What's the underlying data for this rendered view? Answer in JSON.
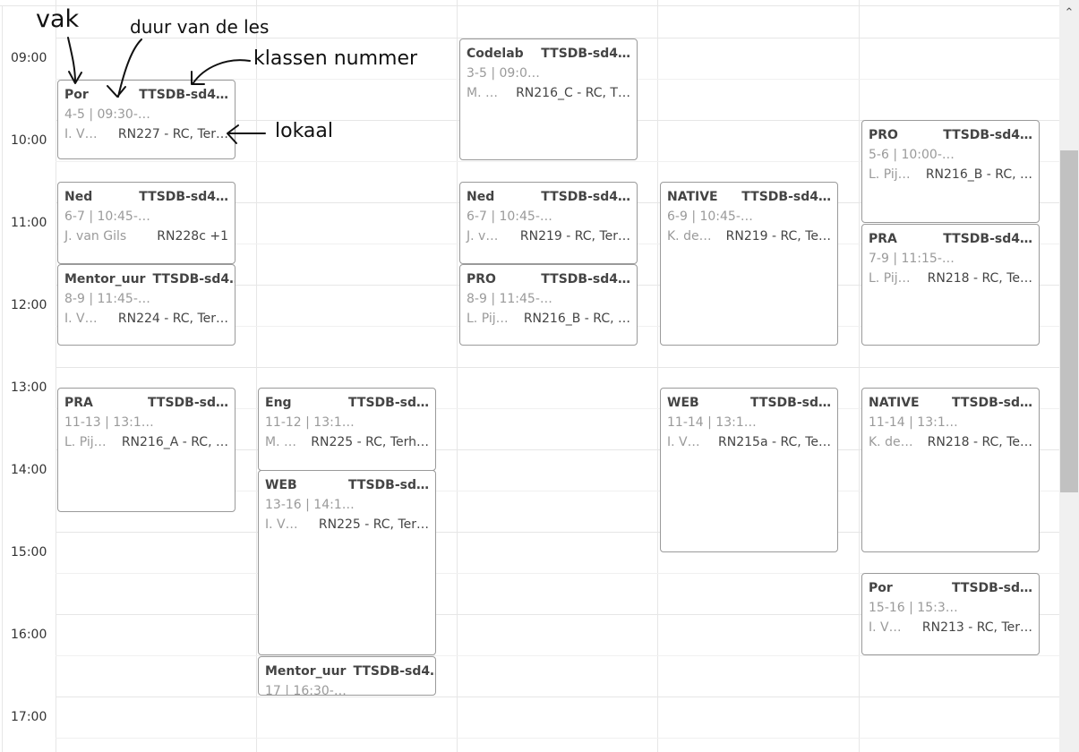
{
  "time_labels": [
    "09:00",
    "10:00",
    "11:00",
    "12:00",
    "13:00",
    "14:00",
    "15:00",
    "16:00",
    "17:00"
  ],
  "annotations": {
    "subject": "vak",
    "duration": "duur van de les",
    "class_number": "klassen nummer",
    "room": "lokaal"
  },
  "events": [
    {
      "subject": "Por",
      "class": "TTSDB-sd4…",
      "time": "4-5 | 09:30-…",
      "teacher": "I. V…",
      "room": "RN227 - RC, Ter…"
    },
    {
      "subject": "Ned",
      "class": "TTSDB-sd4…",
      "time": "6-7 | 10:45-…",
      "teacher": "J. van Gils",
      "room": "RN228c +1"
    },
    {
      "subject": "Mentor_uur",
      "class": "TTSDB-sd4…",
      "time": "8-9 | 11:45-…",
      "teacher": "I. V…",
      "room": "RN224 - RC, Ter…"
    },
    {
      "subject": "PRA",
      "class": "TTSDB-sd…",
      "time": "11-13 | 13:1…",
      "teacher": "L. Pij…",
      "room": "RN216_A - RC, …"
    },
    {
      "subject": "Eng",
      "class": "TTSDB-sd…",
      "time": "11-12 | 13:1…",
      "teacher": "M. …",
      "room": "RN225 - RC, Terh…"
    },
    {
      "subject": "WEB",
      "class": "TTSDB-sd…",
      "time": "13-16 | 14:1…",
      "teacher": "I. V…",
      "room": "RN225 - RC, Ter…"
    },
    {
      "subject": "Mentor_uur",
      "class": "TTSDB-sd4…",
      "time": "17 | 16:30-…",
      "teacher": "",
      "room": ""
    },
    {
      "subject": "Codelab",
      "class": "TTSDB-sd4…",
      "time": "3-5 | 09:0…",
      "teacher": "M. …",
      "room": "RN216_C - RC, T…"
    },
    {
      "subject": "Ned",
      "class": "TTSDB-sd4…",
      "time": "6-7 | 10:45-…",
      "teacher": "J. v…",
      "room": "RN219 - RC, Ter…"
    },
    {
      "subject": "PRO",
      "class": "TTSDB-sd4…",
      "time": "8-9 | 11:45-…",
      "teacher": "L. Pij…",
      "room": "RN216_B - RC, …"
    },
    {
      "subject": "NATIVE",
      "class": "TTSDB-sd4…",
      "time": "6-9 | 10:45-…",
      "teacher": "K. de…",
      "room": "RN219 - RC, Te…"
    },
    {
      "subject": "WEB",
      "class": "TTSDB-sd…",
      "time": "11-14 | 13:1…",
      "teacher": "I. V…",
      "room": "RN215a - RC, Te…"
    },
    {
      "subject": "PRO",
      "class": "TTSDB-sd4…",
      "time": "5-6 | 10:00-…",
      "teacher": "L. Pij…",
      "room": "RN216_B - RC, …"
    },
    {
      "subject": "PRA",
      "class": "TTSDB-sd4…",
      "time": "7-9 | 11:15-…",
      "teacher": "L. Pij…",
      "room": "RN218 - RC, Te…"
    },
    {
      "subject": "NATIVE",
      "class": "TTSDB-sd…",
      "time": "11-14 | 13:1…",
      "teacher": "K. de…",
      "room": "RN218 - RC, Te…"
    },
    {
      "subject": "Por",
      "class": "TTSDB-sd…",
      "time": "15-16 | 15:3…",
      "teacher": "I. V…",
      "room": "RN213 - RC, Ter…"
    }
  ]
}
